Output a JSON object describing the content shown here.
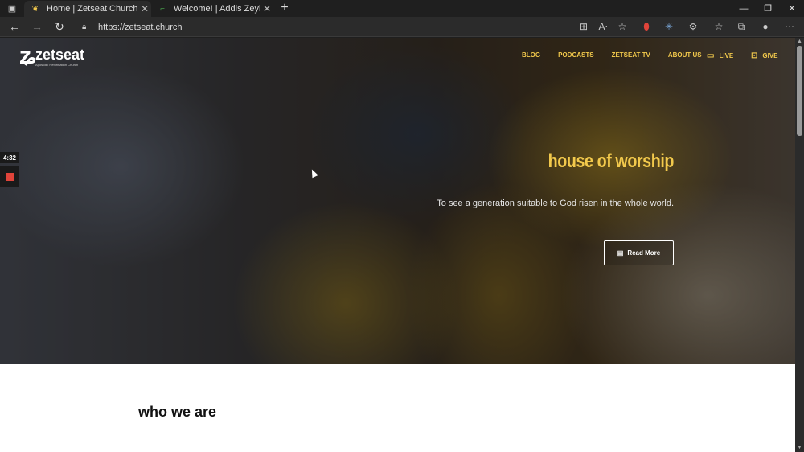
{
  "browser": {
    "window_icon": "window-icon",
    "tabs": [
      {
        "title": "Home | Zetseat Church",
        "active": true
      },
      {
        "title": "Welcome! | Addis Zeybe - Digital",
        "active": false
      }
    ],
    "address": "https://zetseat.church"
  },
  "site": {
    "logo_name": "zetseat",
    "logo_tagline": "Apostolic Reformation Church",
    "nav": [
      "BLOG",
      "PODCASTS",
      "ZETSEAT TV",
      "ABOUT US"
    ],
    "live_label": "LIVE",
    "give_label": "GIVE",
    "hero_heading": "house of worship",
    "hero_subtitle": "To see a generation suitable to God risen in the whole world.",
    "read_more_label": "Read More",
    "section_title": "who we are"
  },
  "recorder": {
    "timer": "4:32"
  },
  "colors": {
    "accent": "#f2c94c",
    "record_stop": "#e0443a"
  }
}
